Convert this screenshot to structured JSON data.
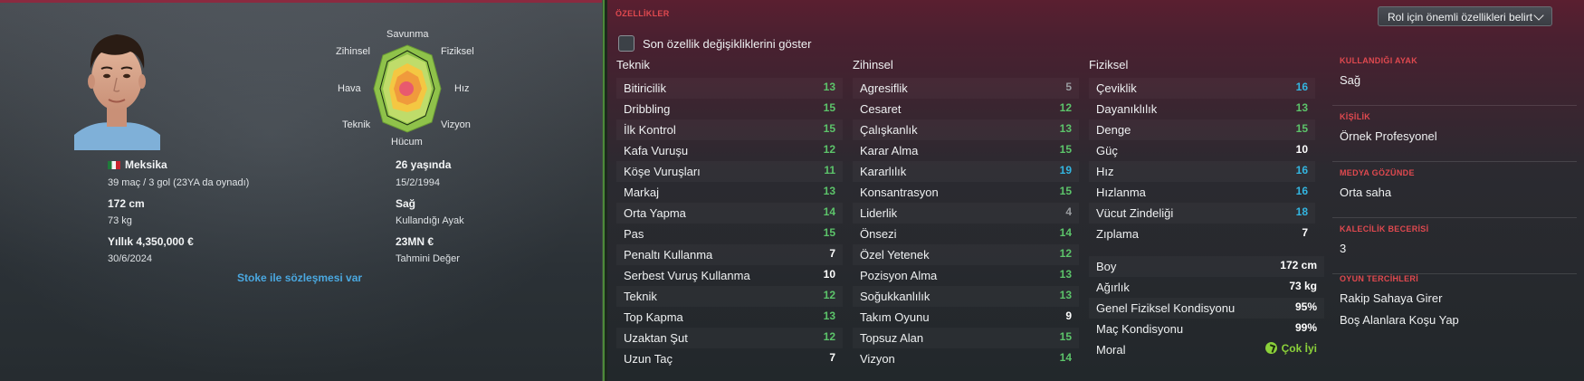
{
  "player": {
    "nation": "Meksika",
    "caps_goals": "39 maç / 3 gol (23YA da oynadı)",
    "height": "172 cm",
    "weight": "73 kg",
    "wage": "Yıllık 4,350,000 €",
    "contract_end": "30/6/2024",
    "age": "26 yaşında",
    "dob": "15/2/1994",
    "foot": "Sağ",
    "foot_label": "Kullandığı Ayak",
    "value": "23MN €",
    "value_label": "Tahmini Değer",
    "contract_link": "Stoke ile sözleşmesi var"
  },
  "radar": {
    "labels": {
      "defence": "Savunma",
      "physical": "Fiziksel",
      "speed": "Hız",
      "vision": "Vizyon",
      "attack": "Hücum",
      "technical": "Teknik",
      "aerial": "Hava",
      "mental": "Zihinsel"
    }
  },
  "header": {
    "section_title": "ÖZELLİKLER",
    "dropdown_label": "Rol için önemli özellikleri belirt",
    "checkbox_label": "Son özellik değişikliklerini göster"
  },
  "colors": {
    "green": "#5cc46a",
    "cyan": "#33b5e0",
    "white": "#ffffff",
    "grey": "#9a9da1",
    "accent_red": "#e0494f"
  },
  "technical": {
    "title": "Teknik",
    "items": [
      {
        "name": "Bitiricilik",
        "value": "13",
        "color": "#5cc46a"
      },
      {
        "name": "Dribbling",
        "value": "15",
        "color": "#5cc46a"
      },
      {
        "name": "İlk Kontrol",
        "value": "15",
        "color": "#5cc46a"
      },
      {
        "name": "Kafa Vuruşu",
        "value": "12",
        "color": "#5cc46a"
      },
      {
        "name": "Köşe Vuruşları",
        "value": "11",
        "color": "#5cc46a"
      },
      {
        "name": "Markaj",
        "value": "13",
        "color": "#5cc46a"
      },
      {
        "name": "Orta Yapma",
        "value": "14",
        "color": "#5cc46a"
      },
      {
        "name": "Pas",
        "value": "15",
        "color": "#5cc46a"
      },
      {
        "name": "Penaltı Kullanma",
        "value": "7",
        "color": "#ffffff"
      },
      {
        "name": "Serbest Vuruş Kullanma",
        "value": "10",
        "color": "#ffffff"
      },
      {
        "name": "Teknik",
        "value": "12",
        "color": "#5cc46a"
      },
      {
        "name": "Top Kapma",
        "value": "13",
        "color": "#5cc46a"
      },
      {
        "name": "Uzaktan Şut",
        "value": "12",
        "color": "#5cc46a"
      },
      {
        "name": "Uzun Taç",
        "value": "7",
        "color": "#ffffff"
      }
    ]
  },
  "mental": {
    "title": "Zihinsel",
    "items": [
      {
        "name": "Agresiflik",
        "value": "5",
        "color": "#9a9da1"
      },
      {
        "name": "Cesaret",
        "value": "12",
        "color": "#5cc46a"
      },
      {
        "name": "Çalışkanlık",
        "value": "13",
        "color": "#5cc46a"
      },
      {
        "name": "Karar Alma",
        "value": "15",
        "color": "#5cc46a"
      },
      {
        "name": "Kararlılık",
        "value": "19",
        "color": "#33b5e0"
      },
      {
        "name": "Konsantrasyon",
        "value": "15",
        "color": "#5cc46a"
      },
      {
        "name": "Liderlik",
        "value": "4",
        "color": "#9a9da1"
      },
      {
        "name": "Önsezi",
        "value": "14",
        "color": "#5cc46a"
      },
      {
        "name": "Özel Yetenek",
        "value": "12",
        "color": "#5cc46a"
      },
      {
        "name": "Pozisyon Alma",
        "value": "13",
        "color": "#5cc46a"
      },
      {
        "name": "Soğukkanlılık",
        "value": "13",
        "color": "#5cc46a"
      },
      {
        "name": "Takım Oyunu",
        "value": "9",
        "color": "#ffffff"
      },
      {
        "name": "Topsuz Alan",
        "value": "15",
        "color": "#5cc46a"
      },
      {
        "name": "Vizyon",
        "value": "14",
        "color": "#5cc46a"
      }
    ]
  },
  "physical": {
    "title": "Fiziksel",
    "items": [
      {
        "name": "Çeviklik",
        "value": "16",
        "color": "#33b5e0"
      },
      {
        "name": "Dayanıklılık",
        "value": "13",
        "color": "#5cc46a"
      },
      {
        "name": "Denge",
        "value": "15",
        "color": "#5cc46a"
      },
      {
        "name": "Güç",
        "value": "10",
        "color": "#ffffff"
      },
      {
        "name": "Hız",
        "value": "16",
        "color": "#33b5e0"
      },
      {
        "name": "Hızlanma",
        "value": "16",
        "color": "#33b5e0"
      },
      {
        "name": "Vücut Zindeliği",
        "value": "18",
        "color": "#33b5e0"
      },
      {
        "name": "Zıplama",
        "value": "7",
        "color": "#ffffff"
      }
    ],
    "extra": [
      {
        "name": "Boy",
        "value": "172 cm"
      },
      {
        "name": "Ağırlık",
        "value": "73 kg"
      },
      {
        "name": "Genel Fiziksel Kondisyonu",
        "value": "95%"
      },
      {
        "name": "Maç Kondisyonu",
        "value": "99%"
      }
    ],
    "morale_label": "Moral",
    "morale_value": "Çok İyi",
    "morale_color": "#8bd13a"
  },
  "side": [
    {
      "head": "KULLANDIĞI AYAK",
      "items": [
        "Sağ"
      ]
    },
    {
      "head": "KİŞİLİK",
      "items": [
        "Örnek Profesyonel"
      ]
    },
    {
      "head": "MEDYA GÖZÜNDE",
      "items": [
        "Orta saha"
      ]
    },
    {
      "head": "KALECİLİK BECERİSİ",
      "items": [
        "3"
      ]
    },
    {
      "head": "OYUN TERCİHLERİ",
      "items": [
        "Rakip Sahaya Girer",
        "Boş Alanlara Koşu Yap"
      ]
    }
  ]
}
